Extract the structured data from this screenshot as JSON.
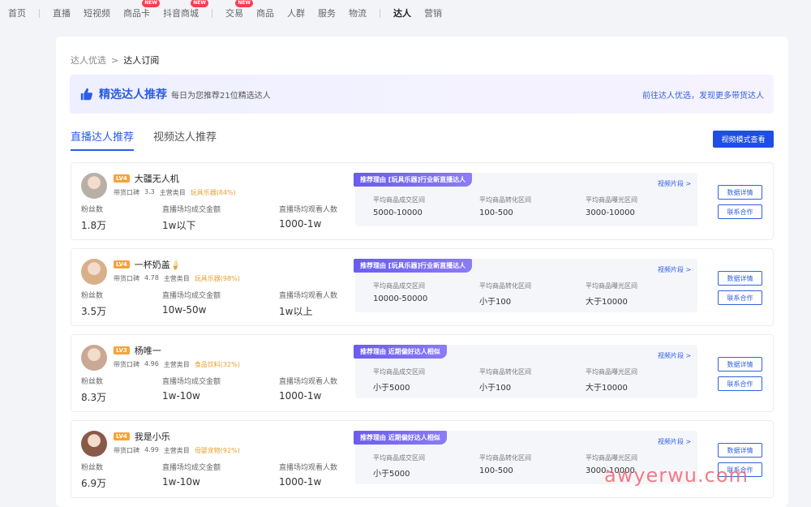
{
  "nav": {
    "items": [
      {
        "label": "首页"
      },
      {
        "sep": true
      },
      {
        "label": "直播"
      },
      {
        "label": "短视频"
      },
      {
        "label": "商品卡",
        "badge": "NEW"
      },
      {
        "label": "抖音商城",
        "badge": "NEW"
      },
      {
        "sep": true
      },
      {
        "label": "交易",
        "badge": "NEW"
      },
      {
        "label": "商品"
      },
      {
        "label": "人群"
      },
      {
        "label": "服务"
      },
      {
        "label": "物流"
      },
      {
        "sep": true
      },
      {
        "label": "达人",
        "active": true
      },
      {
        "label": "营销"
      }
    ]
  },
  "breadcrumb": {
    "parent": "达人优选",
    "separator": ">",
    "current": "达人订阅"
  },
  "banner": {
    "title": "精选达人推荐",
    "subtitle": "每日为您推荐21位精选达人",
    "link": "前往达人优选，发现更多带货达人"
  },
  "tabs": [
    {
      "label": "直播达人推荐",
      "active": true
    },
    {
      "label": "视频达人推荐",
      "active": false
    }
  ],
  "view_mode_button": "视频模式查看",
  "card_labels": {
    "fans": "粉丝数",
    "live_avg_gmv": "直播场均成交金额",
    "live_avg_viewers": "直播场均观看人数",
    "reason_prefix": "推荐理由",
    "avg_order_value": "平均商品成交区间",
    "avg_conversion": "平均商品转化区间",
    "avg_exposure": "平均商品曝光区间",
    "video_link": "视频片段 >",
    "data_button": "数据详情",
    "contact_button": "联系合作",
    "reputation_label": "带货口碑",
    "main_category_label": "主营类目"
  },
  "creators": [
    {
      "level": "LV4",
      "name": "大疆无人机",
      "reputation": "3.3",
      "category": "玩具乐器(84%)",
      "fans": "1.8万",
      "live_avg_gmv": "1w以下",
      "live_avg_viewers": "1000-1w",
      "reason": "推荐理由 [玩具乐器]行业新直播达人",
      "avg_order_value": "5000-10000",
      "avg_conversion": "100-500",
      "avg_exposure": "3000-10000",
      "avatar_color": "#b8b0a6"
    },
    {
      "level": "LV4",
      "name": "一杯奶盖🍦",
      "reputation": "4.78",
      "category": "玩具乐器(98%)",
      "fans": "3.5万",
      "live_avg_gmv": "10w-50w",
      "live_avg_viewers": "1w以上",
      "reason": "推荐理由 [玩具乐器]行业新直播达人",
      "avg_order_value": "10000-50000",
      "avg_conversion": "小于100",
      "avg_exposure": "大于10000",
      "avatar_color": "#d8b08a"
    },
    {
      "level": "LV3",
      "name": "杨唯一",
      "reputation": "4.96",
      "category": "食品饮料(32%)",
      "fans": "8.3万",
      "live_avg_gmv": "1w-10w",
      "live_avg_viewers": "1000-1w",
      "reason": "推荐理由 近期偏好达人相似",
      "avg_order_value": "小于5000",
      "avg_conversion": "小于100",
      "avg_exposure": "大于10000",
      "avatar_color": "#c9a896"
    },
    {
      "level": "LV4",
      "name": "我是小乐",
      "reputation": "4.99",
      "category": "母婴宠物(92%)",
      "fans": "6.9万",
      "live_avg_gmv": "1w-10w",
      "live_avg_viewers": "1000-1w",
      "reason": "推荐理由 近期偏好达人相似",
      "avg_order_value": "小于5000",
      "avg_conversion": "100-500",
      "avg_exposure": "3000-10000",
      "avatar_color": "#8a5a48"
    }
  ],
  "watermark": "awyerwu.com",
  "colors": {
    "accent": "#2b5ce6",
    "level": "#f7a23a",
    "category": "#e8a12c",
    "reason_tag": "#6a5cf0"
  }
}
